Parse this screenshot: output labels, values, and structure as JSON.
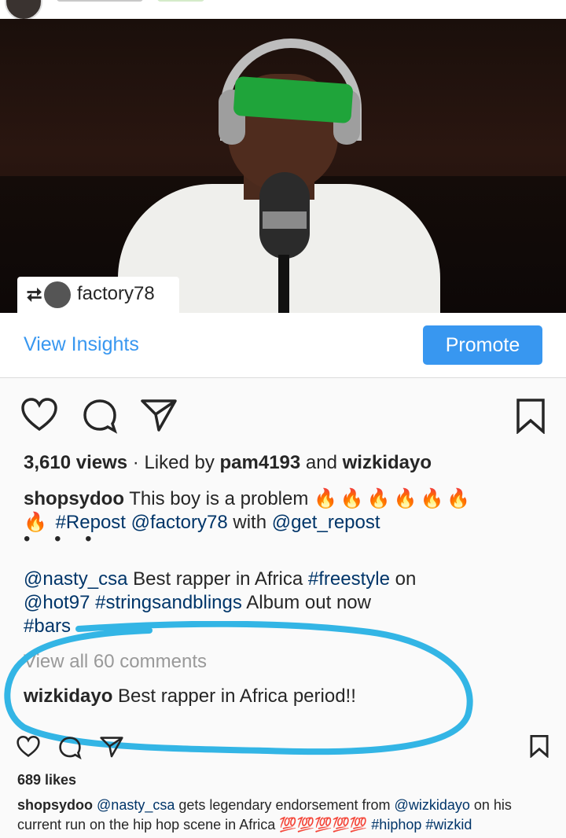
{
  "repost_tag": {
    "username": "factory78"
  },
  "insights": {
    "view_label": "View Insights",
    "promote_label": "Promote"
  },
  "post": {
    "views": "3,610 views",
    "liked_prefix": "Liked by",
    "liker_1": "pam4193",
    "liked_and": "and",
    "liker_2": "wizkidayo",
    "caption_user": "shopsydoo",
    "caption_text": "This boy is a problem",
    "fire_emojis": "🔥🔥🔥🔥🔥🔥",
    "fire_emoji_2": "🔥",
    "tag_repost": "#Repost",
    "mention_factory": "@factory78",
    "with_word": "with",
    "mention_get_repost": "@get_repost",
    "ellipsis_dots": "• • •",
    "mention_nasty": "@nasty_csa",
    "text_best": "Best rapper in Africa",
    "tag_freestyle": "#freestyle",
    "on_word": "on",
    "mention_hot97": "@hot97",
    "tag_strings": "#stringsandblings",
    "text_album": "Album out now",
    "tag_bars": "#bars",
    "view_all_comments": "View all 60 comments",
    "comment_user": "wizkidayo",
    "comment_text": "Best rapper in Africa period!!"
  },
  "post2": {
    "likes": "689 likes",
    "caption_user": "shopsydoo",
    "mention_nasty": "@nasty_csa",
    "text_1": "gets legendary endorsement from",
    "mention_wizkid": "@wizkidayo",
    "text_2": "on his",
    "text_3": "current run on the hip hop scene in Africa",
    "emoji_run": "💯💯💯💯💯",
    "tag_hiphop": "#hiphop",
    "tag_wizkid": "#wizkid"
  },
  "colors": {
    "link_blue": "#3897f0",
    "mention_blue": "#003569",
    "annotation_cyan": "#33b5e5",
    "fire": "#ff5a00"
  }
}
